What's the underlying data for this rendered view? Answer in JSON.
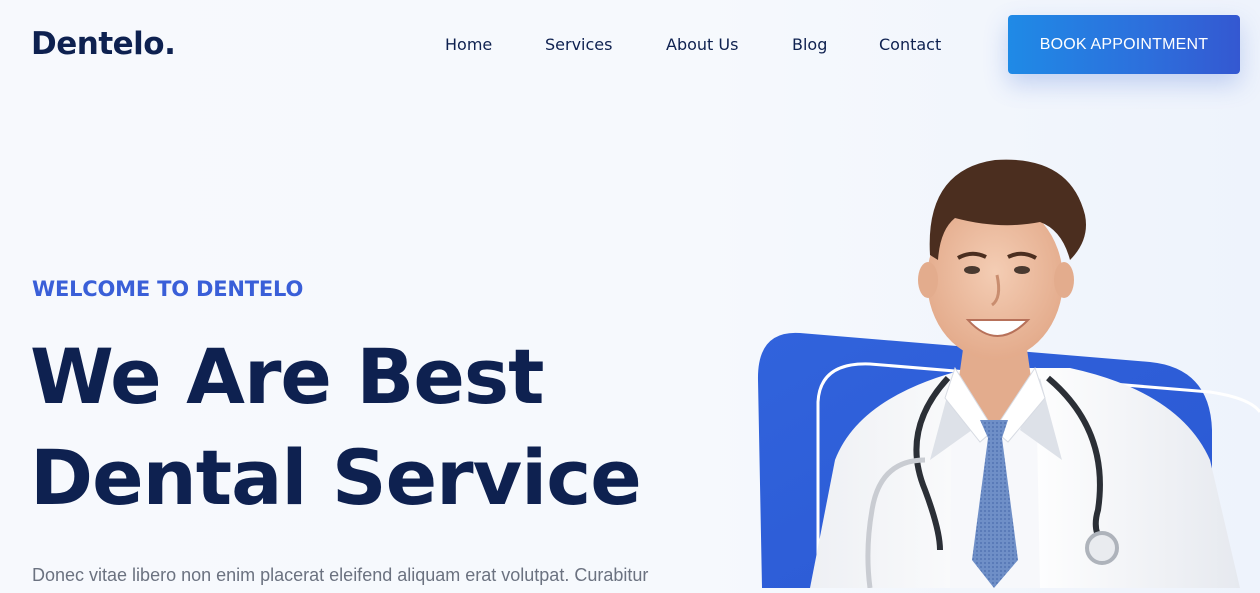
{
  "brand": {
    "logo": "Dentelo."
  },
  "nav": {
    "items": [
      {
        "label": "Home"
      },
      {
        "label": "Services"
      },
      {
        "label": "About Us"
      },
      {
        "label": "Blog"
      },
      {
        "label": "Contact"
      }
    ]
  },
  "header": {
    "cta_label": "BOOK APPOINTMENT"
  },
  "hero": {
    "eyebrow": "WELCOME TO DENTELO",
    "title_line1": "We Are Best",
    "title_line2": "Dental Service",
    "description": "Donec vitae libero non enim placerat eleifend aliquam erat volutpat. Curabitur",
    "image_alt": "smiling-doctor-with-stethoscope"
  },
  "colors": {
    "primary_dark": "#0e2150",
    "accent_blue": "#3a5fd8",
    "cta_start": "#1f8ae6",
    "cta_end": "#3458d1"
  }
}
